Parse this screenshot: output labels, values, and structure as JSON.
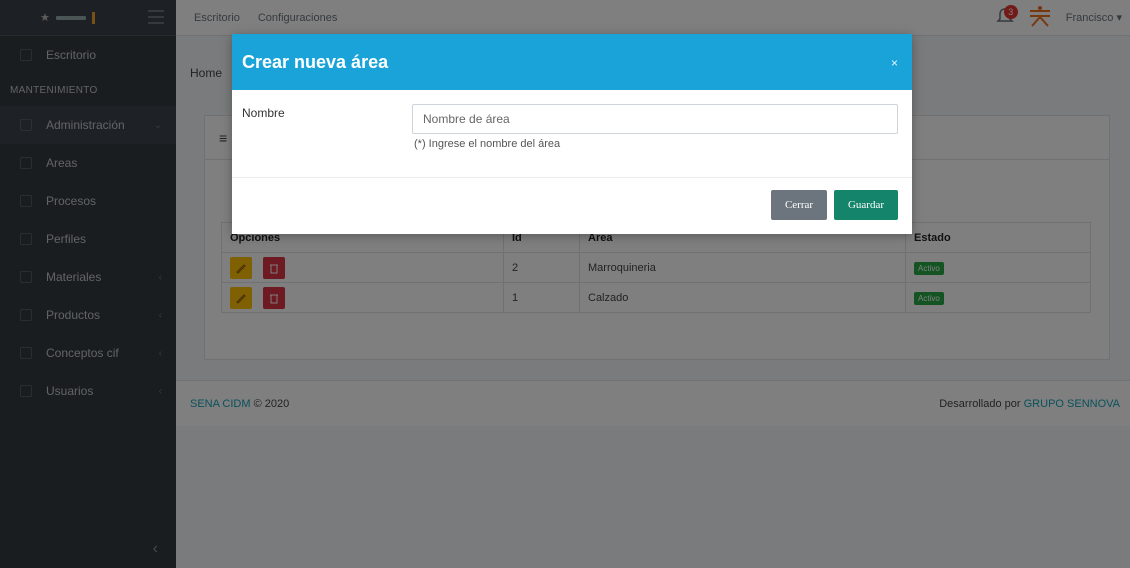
{
  "sidebar": {
    "items": [
      {
        "label": "Escritorio"
      },
      {
        "label": "MANTENIMIENTO"
      },
      {
        "label": "Administración"
      },
      {
        "label": "Areas"
      },
      {
        "label": "Procesos"
      },
      {
        "label": "Perfiles"
      },
      {
        "label": "Materiales"
      },
      {
        "label": "Productos"
      },
      {
        "label": "Conceptos cif"
      },
      {
        "label": "Usuarios"
      }
    ]
  },
  "topbar": {
    "links": [
      "Escritorio",
      "Configuraciones"
    ],
    "notification_count": "3",
    "user_name": "Francisco"
  },
  "breadcrumb": {
    "home": "Home"
  },
  "table": {
    "headers": [
      "Opciones",
      "Id",
      "Area",
      "Estado"
    ],
    "rows": [
      {
        "id": "2",
        "area": "Marroquineria",
        "estado": "Activo"
      },
      {
        "id": "1",
        "area": "Calzado",
        "estado": "Activo"
      }
    ]
  },
  "footer": {
    "left_link": "SENA CIDM",
    "left_text": "© 2020",
    "right_text": "Desarrollado por",
    "right_link": "GRUPO SENNOVA"
  },
  "modal": {
    "title": "Crear nueva área",
    "close_symbol": "×",
    "field_label": "Nombre",
    "field_placeholder": "Nombre de área",
    "field_help": "(*) Ingrese el nombre del área",
    "close_button": "Cerrar",
    "save_button": "Guardar"
  },
  "colors": {
    "modal_header": "#1aa3d9",
    "save_button": "#14856b",
    "sidebar": "#343a40"
  }
}
